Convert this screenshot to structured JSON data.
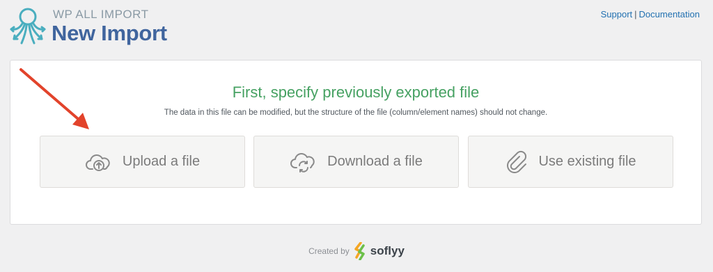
{
  "header": {
    "brand_sub": "WP ALL IMPORT",
    "title": "New Import",
    "links": {
      "support": "Support",
      "separator": "|",
      "documentation": "Documentation"
    }
  },
  "panel": {
    "title": "First, specify previously exported file",
    "description": "The data in this file can be modified, but the structure of the file (column/element names) should not change.",
    "options": [
      {
        "label": "Upload a file",
        "icon": "cloud-upload-icon"
      },
      {
        "label": "Download a file",
        "icon": "cloud-sync-icon"
      },
      {
        "label": "Use existing file",
        "icon": "paperclip-icon"
      }
    ]
  },
  "footer": {
    "created_by": "Created by",
    "brand": "soflyy"
  },
  "colors": {
    "accent_title": "#40659e",
    "panel_title": "#46a162",
    "arrow": "#e2432b",
    "link": "#2271b1"
  }
}
